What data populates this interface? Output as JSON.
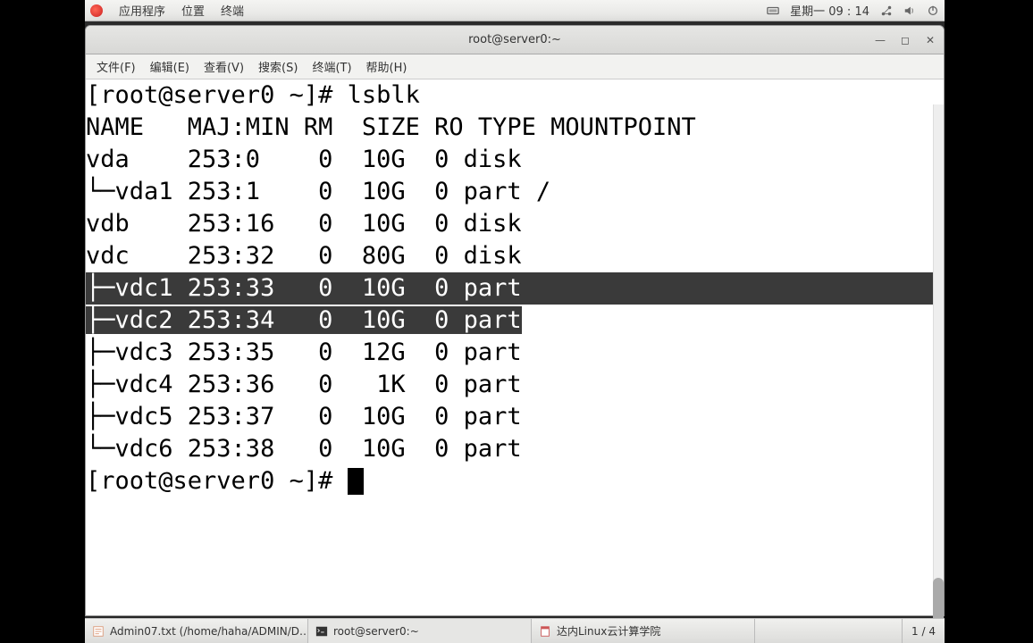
{
  "panel": {
    "apps": "应用程序",
    "places": "位置",
    "terminal": "终端",
    "clock": "星期一 09 : 14"
  },
  "window": {
    "title": "root@server0:~"
  },
  "menu": {
    "file": "文件(F)",
    "edit": "编辑(E)",
    "view": "查看(V)",
    "search": "搜索(S)",
    "terminal": "终端(T)",
    "help": "帮助(H)"
  },
  "term": {
    "prompt1": "[root@server0 ~]# lsblk",
    "header": "NAME   MAJ:MIN RM  SIZE RO TYPE MOUNTPOINT",
    "vda": "vda    253:0    0  10G  0 disk ",
    "vda1": "└─vda1 253:1    0  10G  0 part /",
    "vdb": "vdb    253:16   0  10G  0 disk ",
    "vdc": "vdc    253:32   0  80G  0 disk ",
    "vdc1": "├─vdc1 253:33   0  10G  0 part ",
    "vdc2a": "├─vdc2 253:34   0  10G  0 part",
    "vdc2b": " ",
    "vdc3": "├─vdc3 253:35   0  12G  0 part ",
    "vdc4": "├─vdc4 253:36   0   1K  0 part ",
    "vdc5": "├─vdc5 253:37   0  10G  0 part ",
    "vdc6": "└─vdc6 253:38   0  10G  0 part ",
    "prompt2": "[root@server0 ~]# "
  },
  "taskbar": {
    "t1": "Admin07.txt (/home/haha/ADMIN/D…",
    "t2": "root@server0:~",
    "t3": "达内Linux云计算学院",
    "pager": "1 / 4"
  }
}
